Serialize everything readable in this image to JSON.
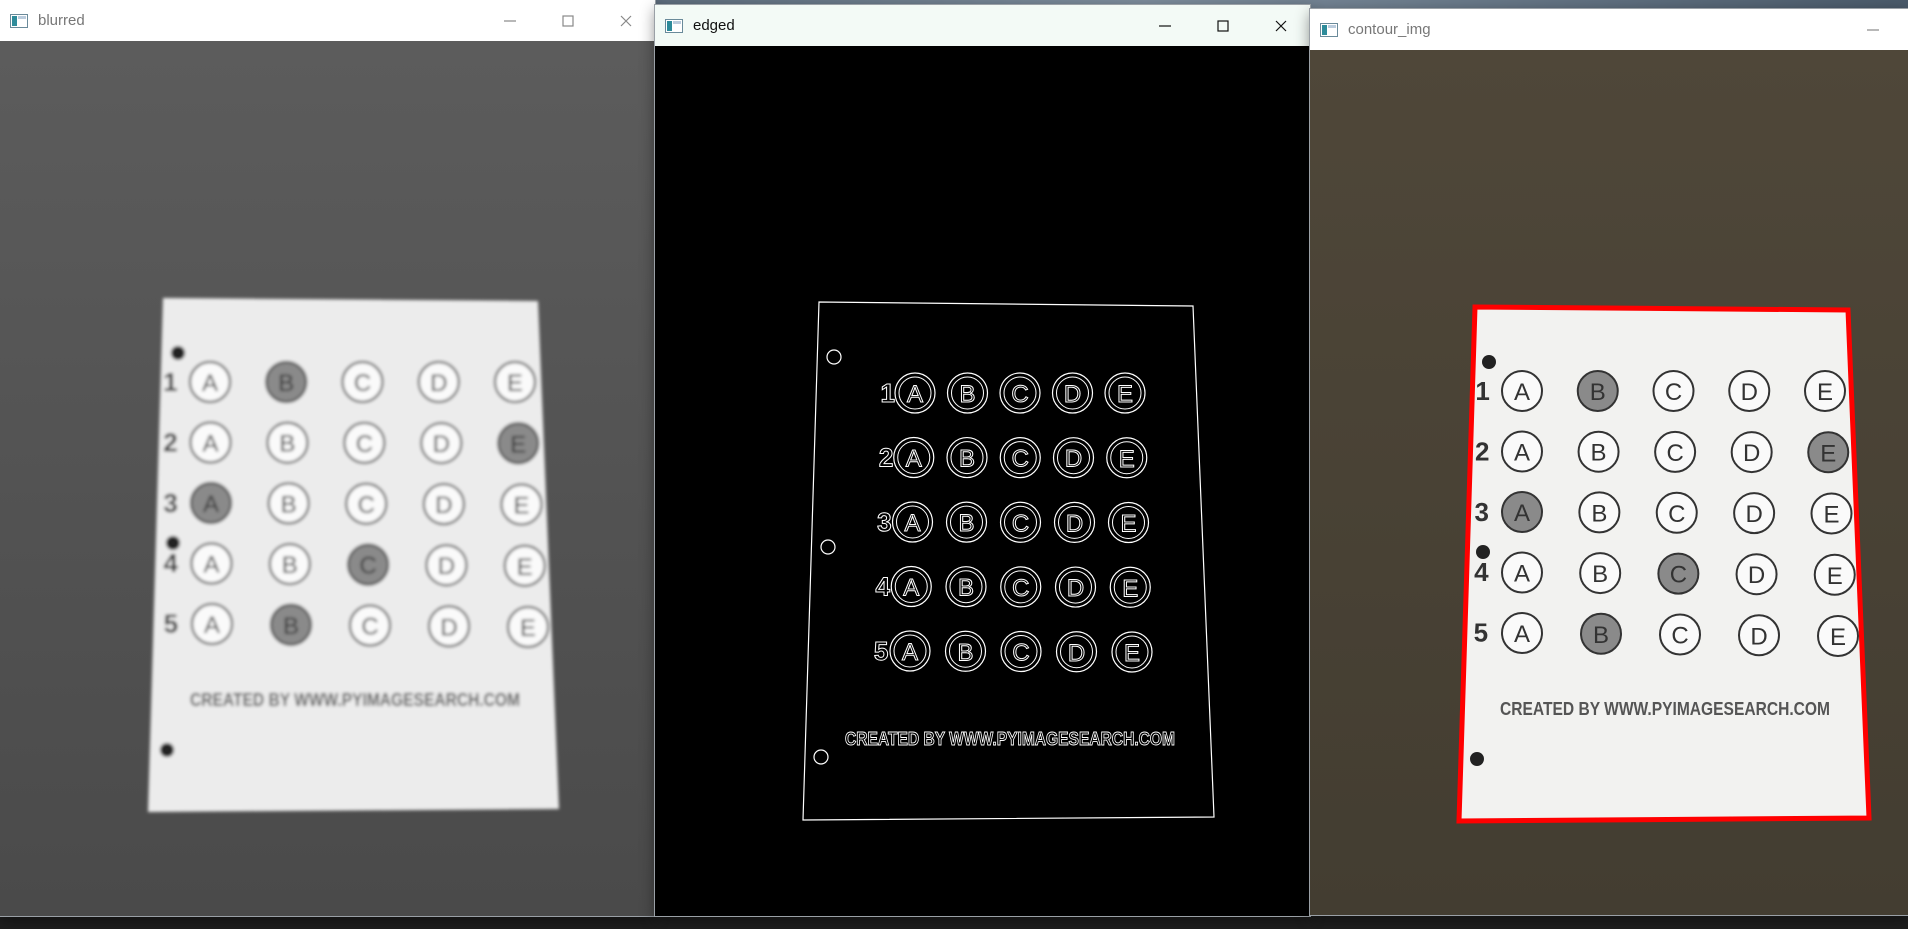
{
  "windows": [
    {
      "title": "blurred",
      "active": false,
      "icon": "opencv-window-icon"
    },
    {
      "title": "edged",
      "active": true,
      "icon": "opencv-window-icon"
    },
    {
      "title": "contour_img",
      "active": false,
      "icon": "opencv-window-icon"
    }
  ],
  "window_controls": {
    "minimize": "minimize-icon",
    "maximize": "maximize-icon",
    "close": "close-icon"
  },
  "sheet": {
    "rows": [
      "1",
      "2",
      "3",
      "4",
      "5"
    ],
    "options": [
      "A",
      "B",
      "C",
      "D",
      "E"
    ],
    "filled": [
      "B",
      "E",
      "A",
      "C",
      "B"
    ],
    "footer": "CREATED BY WWW.PYIMAGESEARCH.COM"
  },
  "colors": {
    "blurred_bg": "#555555",
    "edged_bg": "#000000",
    "contour_bg": "#4a4336",
    "contour_outline": "#ff0000",
    "bubble_fill": "#8a8a8a"
  }
}
